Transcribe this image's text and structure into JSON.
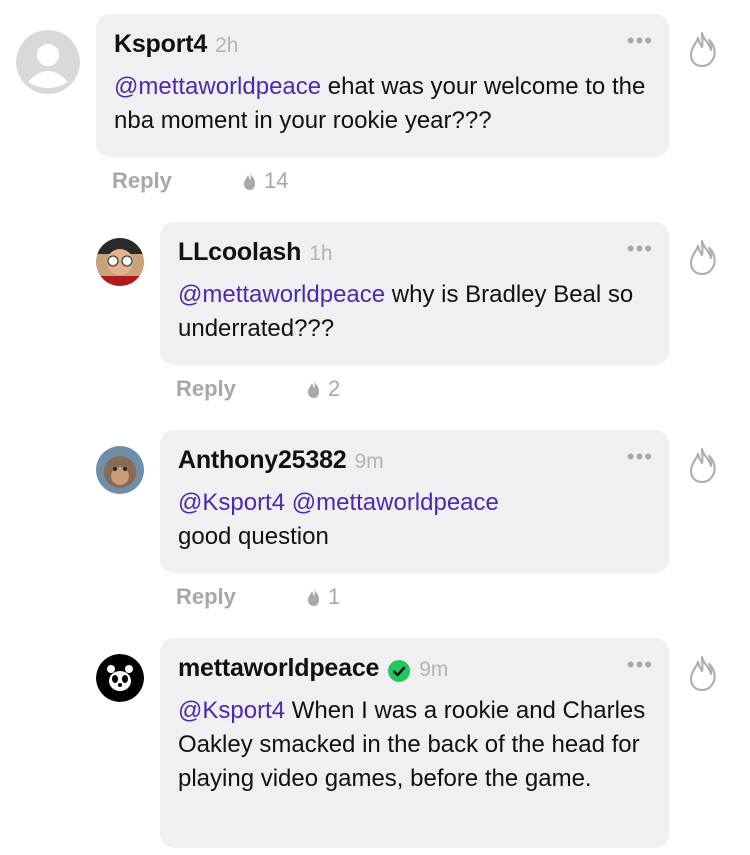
{
  "comments": [
    {
      "username": "Ksport4",
      "time": "2h",
      "mentions": [
        "@mettaworldpeace"
      ],
      "text": " ehat was your welcome to the nba moment in your rookie year???",
      "reply_label": "Reply",
      "likes": "14",
      "avatar": "default-avatar-icon"
    },
    {
      "username": "LLcoolash",
      "time": "1h",
      "mentions": [
        "@mettaworldpeace"
      ],
      "text": " why is Bradley Beal so underrated???",
      "reply_label": "Reply",
      "likes": "2",
      "avatar": "user-photo"
    },
    {
      "username": "Anthony25382",
      "time": "9m",
      "mentions": [
        "@Ksport4",
        "@mettaworldpeace"
      ],
      "text": "good question",
      "reply_label": "Reply",
      "likes": "1",
      "avatar": "monkey-photo"
    },
    {
      "username": "mettaworldpeace",
      "time": "9m",
      "verified": true,
      "mentions": [
        "@Ksport4"
      ],
      "text": " When I was a rookie and Charles Oakley smacked in the back of the head for playing video games, before the game.",
      "avatar": "panda-logo"
    }
  ],
  "ui": {
    "more_glyph": "•••",
    "accent_color": "#4b2ab0",
    "verified_color": "#22c55e"
  }
}
